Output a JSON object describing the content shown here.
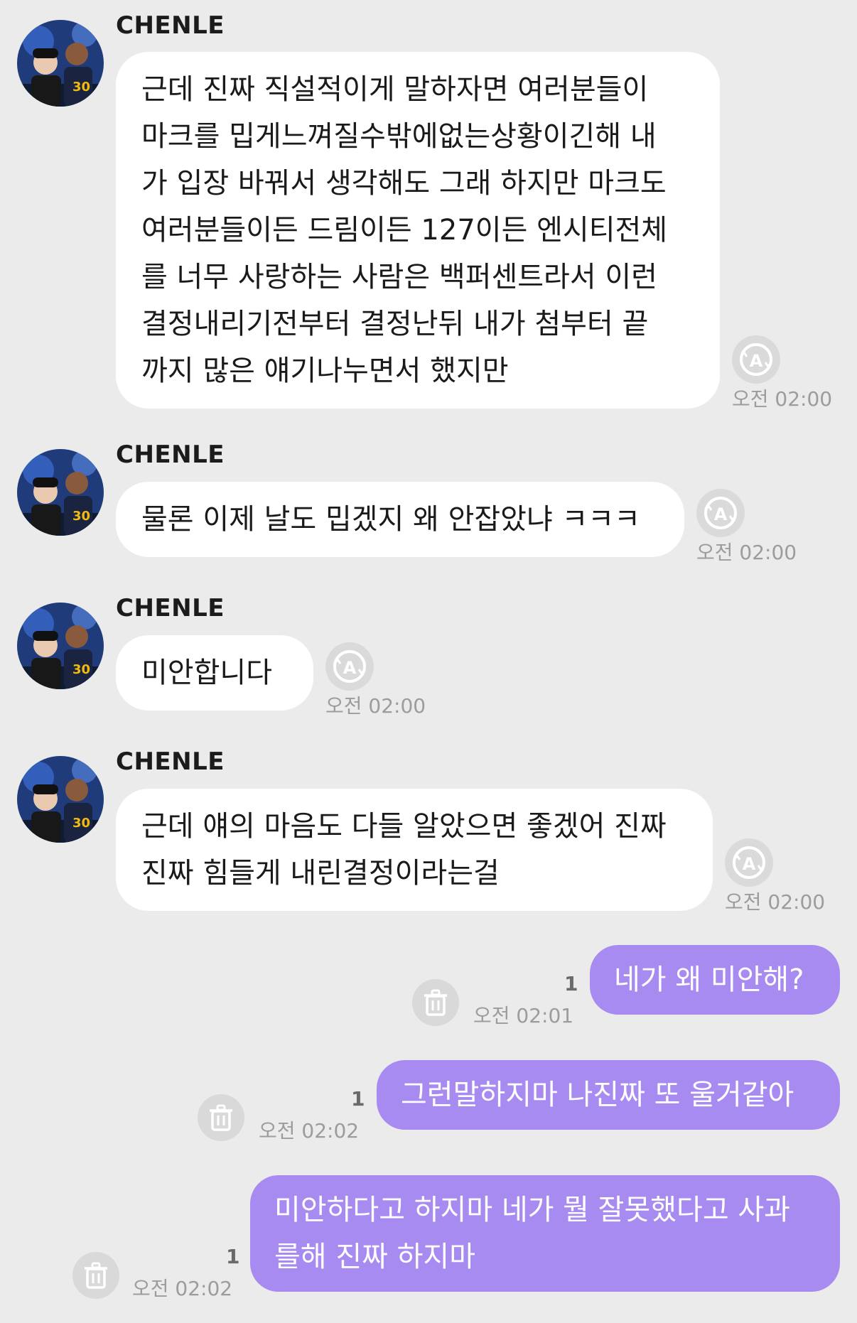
{
  "messages_in": [
    {
      "sender": "CHENLE",
      "lines": [
        "근데 진짜 직설적이게 말하자면 여러분들이",
        "마크를 밉게느껴질수밖에없는상황이긴해 내",
        "가 입장 바꿔서 생각해도 그래 하지만 마크도",
        "여러분들이든 드림이든 127이든 엔시티전체",
        "를 너무 사랑하는 사람은 백퍼센트라서 이런",
        "결정내리기전부터 결정난뒤 내가 첨부터 끝",
        "까지 많은 얘기나누면서 했지만"
      ],
      "time": "오전 02:00"
    },
    {
      "sender": "CHENLE",
      "lines": [
        "물론 이제 날도 밉겠지 왜 안잡았냐 ㅋㅋㅋ"
      ],
      "time": "오전 02:00"
    },
    {
      "sender": "CHENLE",
      "lines": [
        "미안합니다"
      ],
      "time": "오전 02:00"
    },
    {
      "sender": "CHENLE",
      "lines": [
        "근데 얘의 마음도 다들 알았으면 좋겠어 진짜",
        "진짜 힘들게 내린결정이라는걸"
      ],
      "time": "오전 02:00"
    }
  ],
  "messages_out": [
    {
      "lines": [
        "네가 왜 미안해?"
      ],
      "unread": "1",
      "time": "오전 02:01"
    },
    {
      "lines": [
        "그런말하지마 나진짜 또 울거같아"
      ],
      "unread": "1",
      "time": "오전 02:02"
    },
    {
      "lines": [
        "미안하다고 하지마 네가 뭘 잘못했다고 사과",
        "를해 진짜 하지마"
      ],
      "unread": "1",
      "time": "오전 02:02"
    }
  ],
  "icons": {
    "translate": "translate-icon",
    "delete": "trash-icon",
    "avatar": "avatar"
  },
  "colors": {
    "background": "#ebebeb",
    "incoming_bubble": "#ffffff",
    "outgoing_bubble": "#a78bf0",
    "timestamp": "#9c9c9c"
  }
}
